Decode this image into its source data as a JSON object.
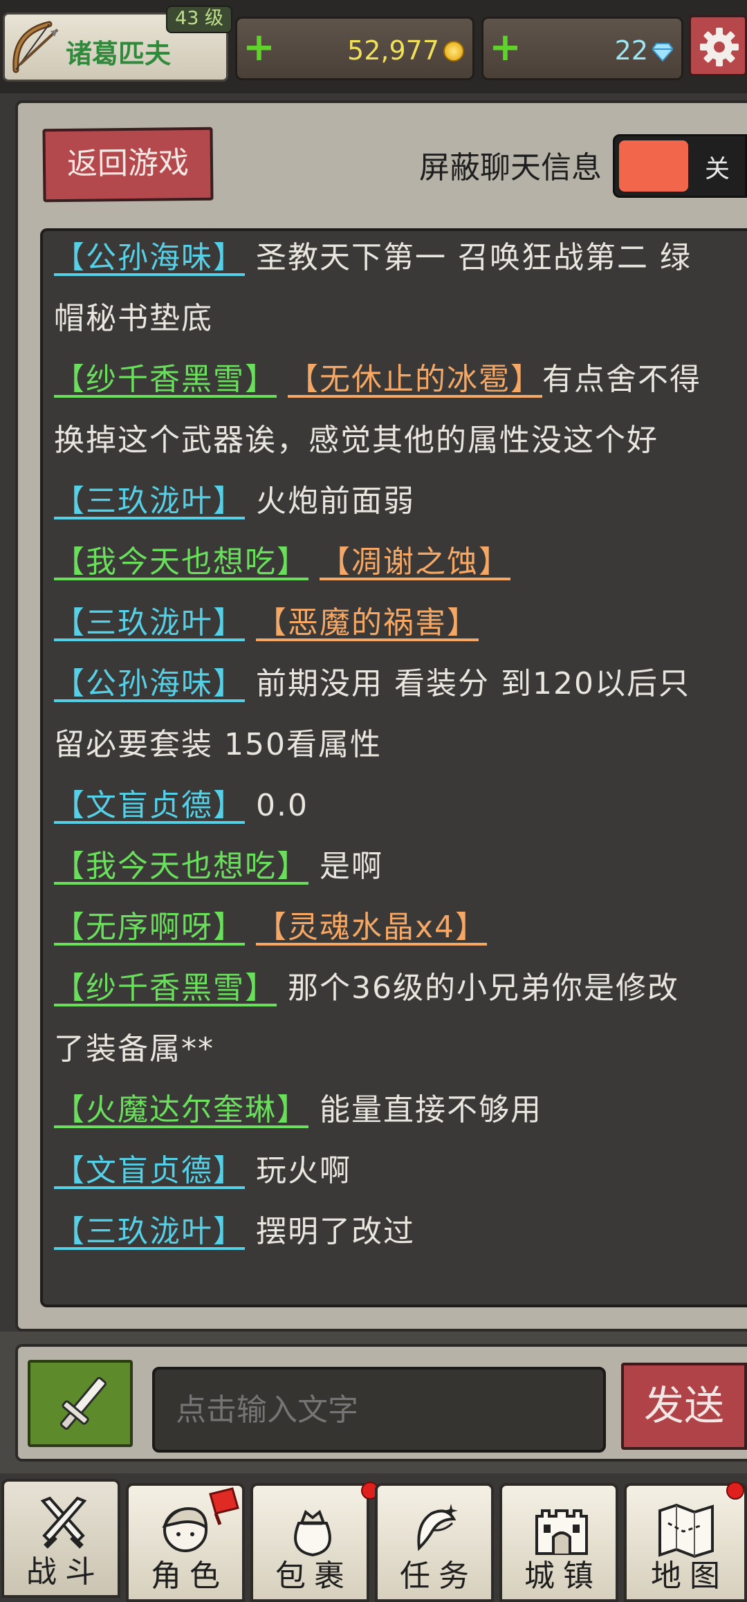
{
  "player": {
    "name": "诸葛匹夫",
    "level": "43 级"
  },
  "resources": {
    "gold": "52,977",
    "gems": "22",
    "plus_label": "+"
  },
  "chat": {
    "back_label": "返回游戏",
    "block_label": "屏蔽聊天信息",
    "block_state": "关",
    "messages": [
      {
        "name": "【公孙海味】",
        "name_color": "cyan",
        "text": "圣教天下第一 召唤狂战第二 绿",
        "cont": "帽秘书垫底"
      },
      {
        "name": "【纱千香黑雪】",
        "name_color": "green",
        "item": "【无休止的冰雹】",
        "text": "有点舍不得",
        "cont": "换掉这个武器诶，感觉其他的属性没这个好"
      },
      {
        "name": "【三玖泷叶】",
        "name_color": "cyan",
        "text": "火炮前面弱"
      },
      {
        "name": "【我今天也想吃】",
        "name_color": "green",
        "item": "【凋谢之蚀】"
      },
      {
        "name": "【三玖泷叶】",
        "name_color": "cyan",
        "item": "【恶魔的祸害】"
      },
      {
        "name": "【公孙海味】",
        "name_color": "cyan",
        "text": "前期没用 看装分 到120以后只",
        "cont": "留必要套装 150看属性"
      },
      {
        "name": "【文盲贞德】",
        "name_color": "cyan",
        "text": "0.0"
      },
      {
        "name": "【我今天也想吃】",
        "name_color": "green",
        "text": "是啊"
      },
      {
        "name": "【无序啊呀】",
        "name_color": "green",
        "item": "【灵魂水晶x4】"
      },
      {
        "name": "【纱千香黑雪】",
        "name_color": "green",
        "text": "那个36级的小兄弟你是修改",
        "cont": "了装备属**"
      },
      {
        "name": "【火魔达尔奎琳】",
        "name_color": "green",
        "text": "能量直接不够用"
      },
      {
        "name": "【文盲贞德】",
        "name_color": "cyan",
        "text": "玩火啊"
      },
      {
        "name": "【三玖泷叶】",
        "name_color": "cyan",
        "text": "摆明了改过"
      }
    ]
  },
  "input": {
    "placeholder": "点击输入文字",
    "send_label": "发送"
  },
  "nav": {
    "tabs": [
      {
        "label": "战斗",
        "icon": "crossed-swords-icon"
      },
      {
        "label": "角色",
        "icon": "character-icon"
      },
      {
        "label": "包裹",
        "icon": "bag-icon"
      },
      {
        "label": "任务",
        "icon": "quest-icon"
      },
      {
        "label": "城镇",
        "icon": "castle-icon"
      },
      {
        "label": "地图",
        "icon": "map-icon"
      }
    ]
  },
  "colors": {
    "cyan": "#56d0e6",
    "green": "#69df5c",
    "orange": "#f5a865",
    "accent_red": "#b04347"
  }
}
